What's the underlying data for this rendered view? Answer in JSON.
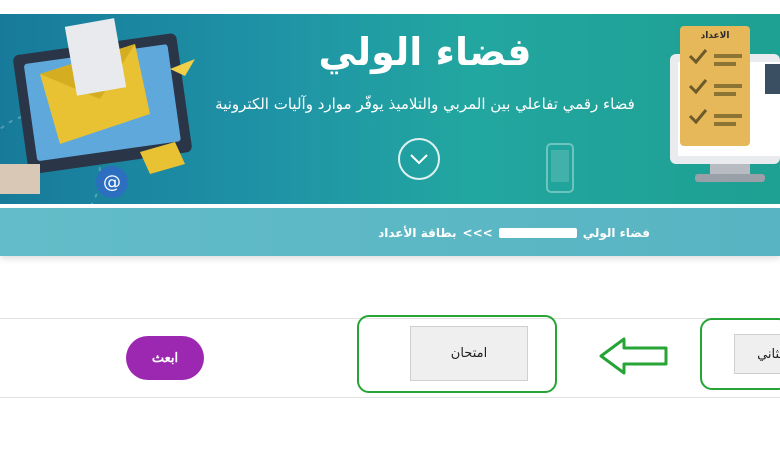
{
  "hero": {
    "title": "فضاء الولي",
    "subtitle": "فضاء رقمي تفاعلي بين المربي والتلاميذ يوفّر موارد وآليات الكترونية",
    "board_label": "الاعداد",
    "scroll_icon": "chevron-down-icon"
  },
  "breadcrumb": {
    "home": "فضاء الولي",
    "separator": ">>>",
    "current": "بطاقة الأعداد"
  },
  "form": {
    "exam_select_value": "امتحان",
    "term_select_value": "الثاني",
    "search_label": "ابعث"
  },
  "colors": {
    "hero_teal": "#1f93a6",
    "breadcrumb_bar": "#5fb8c6",
    "search_button": "#9c27b0",
    "highlight_green": "#26a436"
  }
}
